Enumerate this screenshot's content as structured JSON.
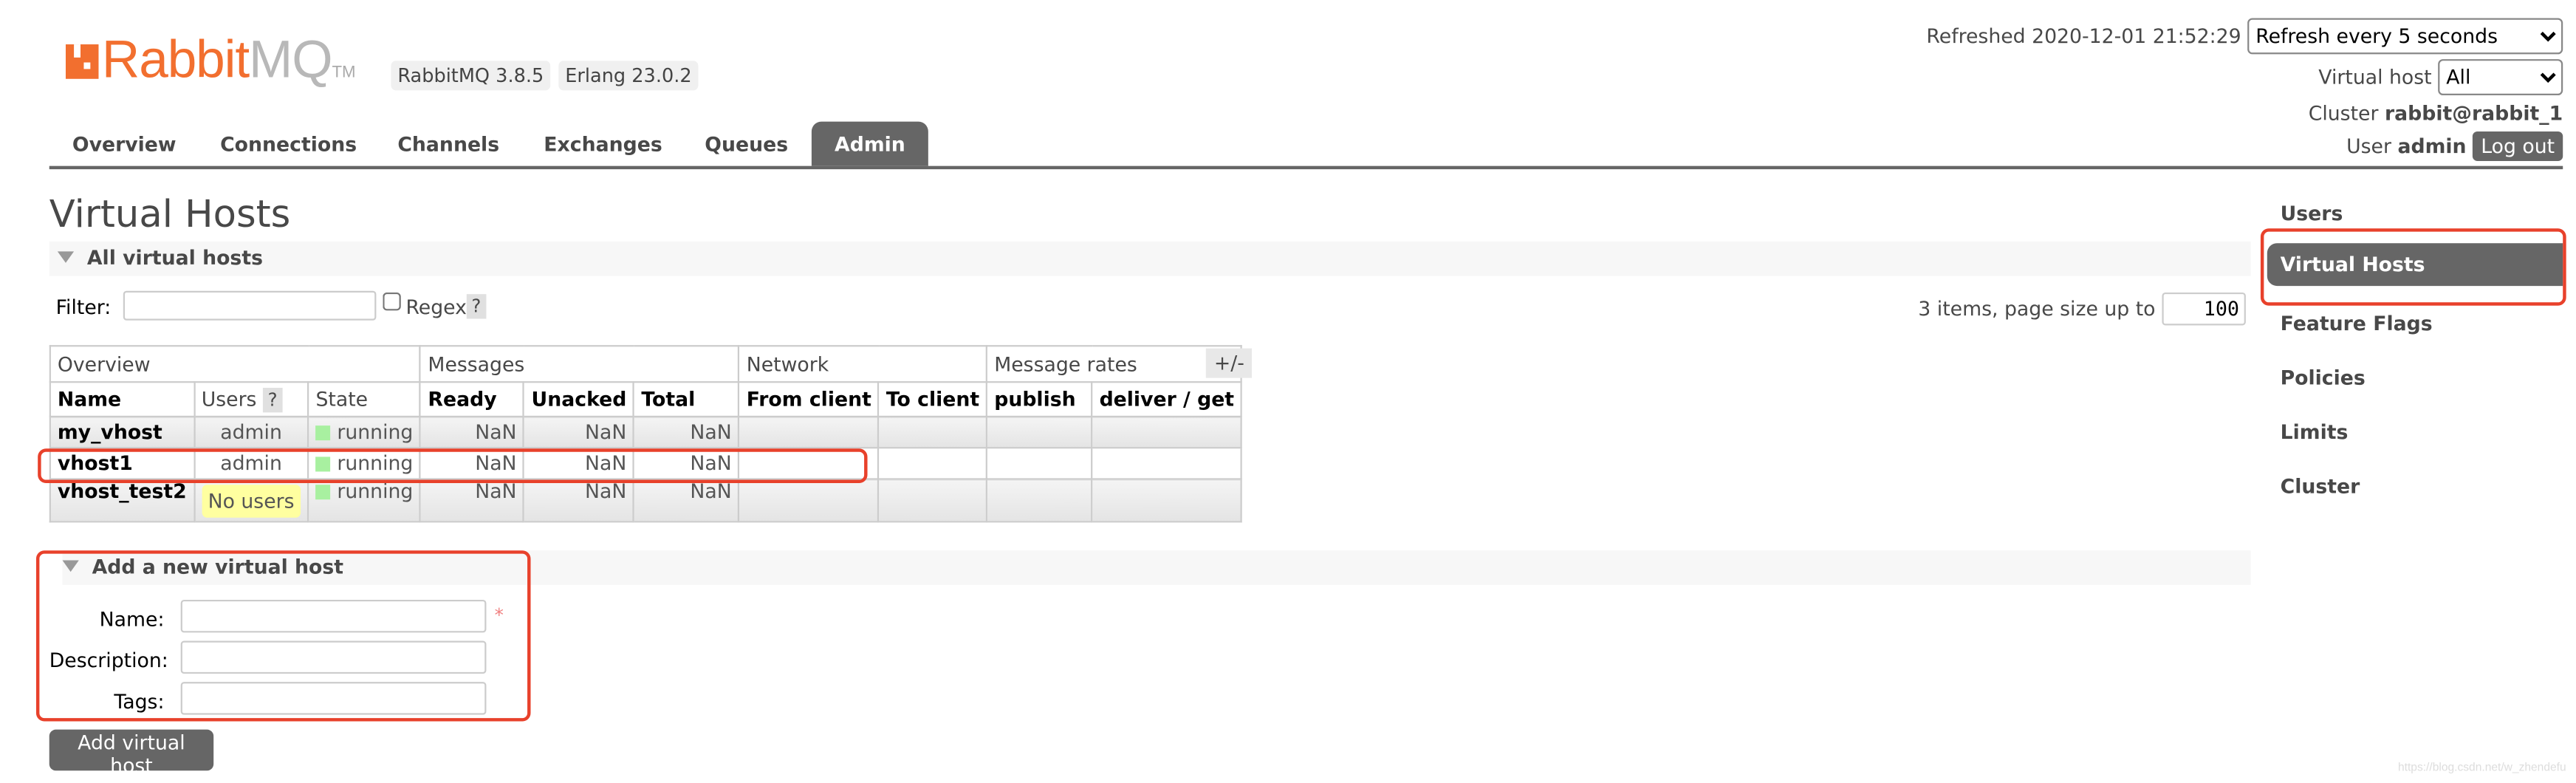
{
  "header": {
    "logo_text_rabbit": "Rabbit",
    "logo_text_mq": "MQ",
    "logo_tm": "TM",
    "version_badge": "RabbitMQ 3.8.5",
    "erlang_badge": "Erlang 23.0.2",
    "refreshed": "Refreshed 2020-12-01 21:52:29",
    "refresh_select": "Refresh every 5 seconds",
    "vhost_label": "Virtual host",
    "vhost_select": "All",
    "cluster_label": "Cluster",
    "cluster_name": "rabbit@rabbit_1",
    "user_label": "User",
    "user_name": "admin",
    "logout": "Log out"
  },
  "nav": {
    "tabs": [
      {
        "label": "Overview"
      },
      {
        "label": "Connections"
      },
      {
        "label": "Channels"
      },
      {
        "label": "Exchanges"
      },
      {
        "label": "Queues"
      },
      {
        "label": "Admin",
        "active": true
      }
    ]
  },
  "page": {
    "title": "Virtual Hosts"
  },
  "all_vhosts": {
    "section_title": "All virtual hosts",
    "filter_label": "Filter:",
    "filter_value": "",
    "regex_label": "Regex",
    "help": "?",
    "items_text": "3 items, page size up to",
    "page_size": "100",
    "toggle_columns": "+/-",
    "groups": [
      "Overview",
      "Messages",
      "Network",
      "Message rates"
    ],
    "columns": [
      "Name",
      "Users",
      "State",
      "Ready",
      "Unacked",
      "Total",
      "From client",
      "To client",
      "publish",
      "deliver / get"
    ],
    "rows": [
      {
        "name": "my_vhost",
        "users": "admin",
        "state": "running",
        "ready": "NaN",
        "unacked": "NaN",
        "total": "NaN"
      },
      {
        "name": "vhost1",
        "users": "admin",
        "state": "running",
        "ready": "NaN",
        "unacked": "NaN",
        "total": "NaN"
      },
      {
        "name": "vhost_test2",
        "users": "No users",
        "state": "running",
        "ready": "NaN",
        "unacked": "NaN",
        "total": "NaN"
      }
    ]
  },
  "add_vhost": {
    "section_title": "Add a new virtual host",
    "name_label": "Name:",
    "description_label": "Description:",
    "tags_label": "Tags:",
    "required_mark": "*",
    "submit": "Add virtual host"
  },
  "sidebar": {
    "items": [
      {
        "label": "Users"
      },
      {
        "label": "Virtual Hosts",
        "active": true
      },
      {
        "label": "Feature Flags"
      },
      {
        "label": "Policies"
      },
      {
        "label": "Limits"
      },
      {
        "label": "Cluster"
      }
    ]
  },
  "watermark": "https://blog.csdn.net/w_zhendefu",
  "colors": {
    "brand": "#f26f2f",
    "active_tab": "#666666",
    "annotation_box": "#e8412b",
    "running": "#a8f0a0",
    "no_users": "#ffffa0"
  }
}
